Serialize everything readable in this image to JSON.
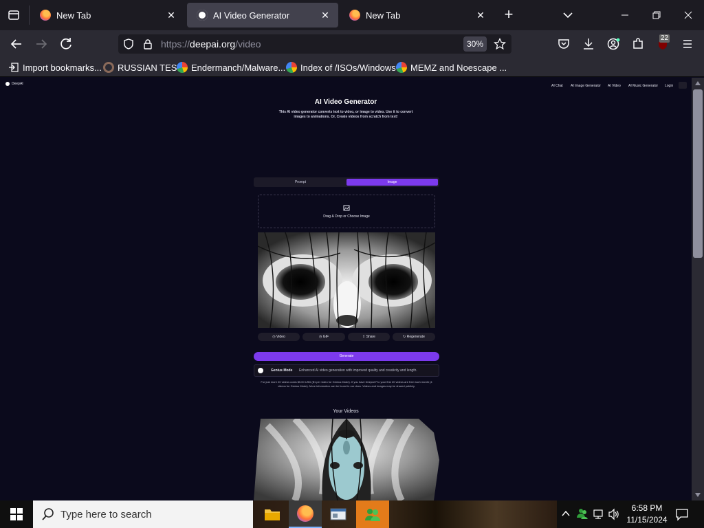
{
  "tabs": [
    {
      "title": "New Tab",
      "active": false
    },
    {
      "title": "AI Video Generator",
      "active": true
    },
    {
      "title": "New Tab",
      "active": false
    }
  ],
  "url": {
    "prefix": "https://",
    "domain": "deepai.org",
    "path": "/video"
  },
  "zoom": "30%",
  "extensions_badge": "22",
  "bookmarks": [
    "Import bookmarks...",
    "RUSSIAN TEST",
    "Endermanch/Malware...",
    "Index of /ISOs/Windows",
    "MEMZ and Noescape ..."
  ],
  "site": {
    "logo": "DeepAI",
    "nav": [
      "AI Chat",
      "AI Image Generator",
      "AI Video",
      "AI Music Generator",
      "Login"
    ],
    "title": "AI Video Generator",
    "subtitle_line1": "This AI video generator converts text to video, or image to video. Use it to convert",
    "subtitle_line2": "images to animations. Or, Create videos from scratch from text!",
    "mode_tabs": [
      "Prompt",
      "Image"
    ],
    "active_mode": "Image",
    "dropzone": "Drag & Drop or Choose Image",
    "actions": [
      "Video",
      "GIF",
      "Share",
      "Regenerate"
    ],
    "generate": "Generate",
    "genius_label": "Genius Mode",
    "genius_desc": "Enhanced AI video generation with improved quality and creativity and length.",
    "pricing_line1": "For just more 20 videos costs $5.00 USD ($1 per video for Genius Mode). If you have DeepAI Pro your first 20 videos are free each month (4",
    "pricing_line2": "videos for Genius Mode). More information can be found in our docs. Videos and images may be shared publicly.",
    "your_videos": "Your Videos"
  },
  "taskbar": {
    "search_placeholder": "Type here to search",
    "time": "6:58 PM",
    "date": "11/15/2024"
  },
  "colors": {
    "accent": "#7c3aed",
    "page_bg": "#0b0a1c",
    "tab_bg": "#1c1b22",
    "toolbar_bg": "#2b2a33"
  }
}
